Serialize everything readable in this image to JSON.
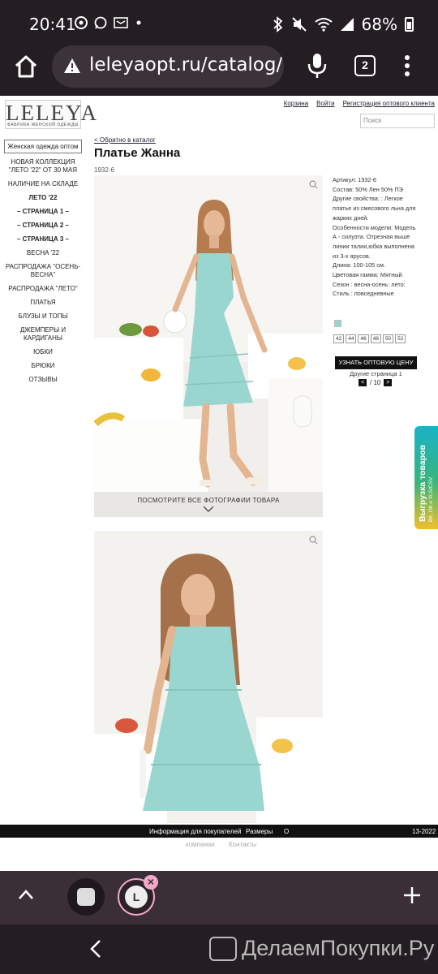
{
  "status_bar": {
    "time": "20:41",
    "battery_percent": "68%",
    "notification_icons": [
      "chrome-icon",
      "whatsapp-icon",
      "ok-icon",
      "dot-icon"
    ],
    "system_icons": [
      "bluetooth-icon",
      "mute-icon",
      "wifi-icon",
      "signal-icon",
      "battery-icon"
    ]
  },
  "browser": {
    "url": "leleyaopt.ru/catalog/no",
    "tab_count": "2"
  },
  "site": {
    "logo_text": "LELEYA",
    "logo_tagline": "ФАБРИКА ЖЕНСКОЙ ОДЕЖДЫ",
    "top_links": [
      "Корзина",
      "Войти",
      "Регистрация оптового клиента"
    ],
    "search_placeholder": "Поиск"
  },
  "sidebar": {
    "header": "Женская одежда оптом",
    "items": [
      {
        "label": "НОВАЯ КОЛЛЕКЦИЯ \"ЛЕТО '22\" ОТ 30 МАЯ",
        "bold": false
      },
      {
        "label": "НАЛИЧИЕ НА СКЛАДЕ",
        "bold": false
      },
      {
        "label": "ЛЕТО '22",
        "bold": true
      },
      {
        "label": "– СТРАНИЦА 1 –",
        "bold": true
      },
      {
        "label": "– СТРАНИЦА 2 –",
        "bold": true
      },
      {
        "label": "– СТРАНИЦА 3 –",
        "bold": true
      },
      {
        "label": "ВЕСНА '22",
        "bold": false
      },
      {
        "label": "РАСПРОДАЖА \"ОСЕНЬ-ВЕСНА\"",
        "bold": false
      },
      {
        "label": "РАСПРОДАЖА \"ЛЕТО\"",
        "bold": false
      },
      {
        "label": "ПЛАТЬЯ",
        "bold": false
      },
      {
        "label": "БЛУЗЫ И ТОПЫ",
        "bold": false
      },
      {
        "label": "ДЖЕМПЕРЫ И КАРДИГАНЫ",
        "bold": false
      },
      {
        "label": "ЮБКИ",
        "bold": false
      },
      {
        "label": "БРЮКИ",
        "bold": false
      },
      {
        "label": "ОТЗЫВЫ",
        "bold": false
      }
    ]
  },
  "product": {
    "breadcrumb": "< Обратно в каталог",
    "title": "Платье Жанна",
    "sku": "1932-6",
    "photo_caption": "ПОСМОТРИТЕ ВСЕ ФОТОГРАФИИ ТОВАРА",
    "details": [
      "Артикул: 1932-6",
      "Состав: 50% Лен 50% ПЭ",
      "Другие свойства: : Легкое платье из смесового льна для жарких дней.",
      "Особенности модели: Модель А - силуэта. Отрезная выше линии талии,юбка выполнена из 3-х ярусов.",
      "Длина: 100-105 см.",
      "Цветовая гамма: Мятный.",
      "Сезон : весна-осень: лето:",
      "Стиль : повседневные"
    ],
    "swatch_color": "#9ad6d0",
    "sizes": [
      "42",
      "44",
      "46",
      "48",
      "50",
      "52"
    ],
    "price_button": "УЗНАТЬ ОПТОВУЮ ЦЕНУ",
    "other_pages": "Другие страница 1",
    "pager_text": "/ 10"
  },
  "export_tab": {
    "title": "Выгрузка товаров",
    "subtitle": "ВК, ОК и XLS/CSV"
  },
  "footer": {
    "links": [
      "Информация для покупателей",
      "Размеры",
      "О"
    ],
    "year_fragment": "13-2022",
    "sub_links": [
      "компании",
      "Контакты"
    ]
  },
  "watermark": "ДелаемПокупки.Ру",
  "colors": {
    "chrome": "#241d22",
    "mint": "#9ad6d0",
    "fab_blue": "#2f8ae6",
    "fab_green": "#3fbe6b"
  }
}
